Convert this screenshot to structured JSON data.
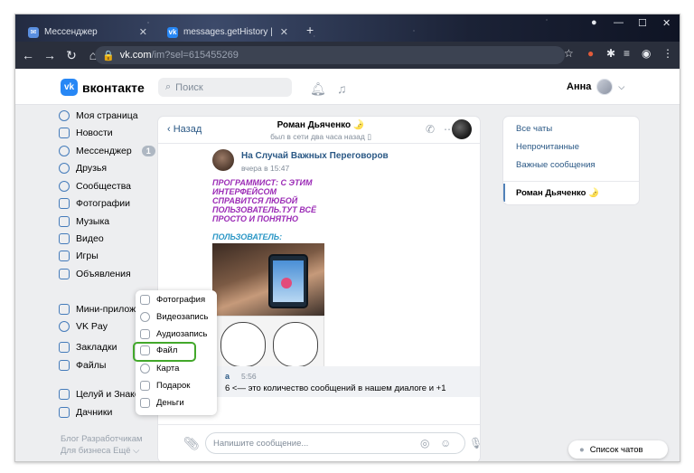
{
  "browser": {
    "tabs": [
      {
        "title": "Мессенджер",
        "icon": "vk-messenger-icon"
      },
      {
        "title": "messages.getHistory | Разработ",
        "icon": "vk-icon"
      }
    ],
    "url_host": "vk.com",
    "url_path": "/im?sel=615455269"
  },
  "header": {
    "logo_text": "вконтакте",
    "search_placeholder": "Поиск",
    "user_name": "Анна"
  },
  "sidebar": {
    "items": [
      {
        "label": "Моя страница"
      },
      {
        "label": "Новости"
      },
      {
        "label": "Мессенджер",
        "badge": "1"
      },
      {
        "label": "Друзья"
      },
      {
        "label": "Сообщества"
      },
      {
        "label": "Фотографии"
      },
      {
        "label": "Музыка"
      },
      {
        "label": "Видео"
      },
      {
        "label": "Игры"
      },
      {
        "label": "Объявления"
      },
      {
        "label": "Мини-приложен"
      },
      {
        "label": "VK Pay"
      },
      {
        "label": "Закладки"
      },
      {
        "label": "Файлы"
      },
      {
        "label": "Целуй и Знаком"
      },
      {
        "label": "Дачники"
      }
    ],
    "footer_line1": "Блог  Разработчикам",
    "footer_line2": "Для бизнеса  Ещё ⌵"
  },
  "chat": {
    "back_label": "Назад",
    "peer_name": "Роман Дьяченко 🌛",
    "peer_status": "был в сети два часа назад ▯",
    "message": {
      "author": "На Случай Важных Переговоров",
      "time": "вчера в 15:47",
      "caption_top": "ПРОГРАММИСТ: С ЭТИМ ИНТЕРФЕЙСОМ СПРАВИТСЯ ЛЮБОЙ ПОЛЬЗОВАТЕЛЬ.ТУТ ВСЁ ПРОСТО И ПОНЯТНО",
      "caption_bottom": "ПОЛЬЗОВАТЕЛЬ:"
    },
    "reply": {
      "author": "а",
      "time": "5:56",
      "text": "6 <— это количество сообщений в нашем диалоге и +1"
    },
    "composer_placeholder": "Напишите сообщение..."
  },
  "attach_menu": {
    "items": [
      {
        "label": "Фотография"
      },
      {
        "label": "Видеозапись"
      },
      {
        "label": "Аудиозапись"
      },
      {
        "label": "Файл"
      },
      {
        "label": "Карта"
      },
      {
        "label": "Подарок"
      },
      {
        "label": "Деньги"
      }
    ],
    "highlight_color": "#43a82b"
  },
  "right_panel": {
    "filters": [
      {
        "label": "Все чаты"
      },
      {
        "label": "Непрочитанные"
      },
      {
        "label": "Важные сообщения"
      }
    ],
    "active_chat": "Роман Дьяченко 🌛"
  },
  "chats_button": "Список чатов",
  "colors": {
    "vk_blue": "#2787f5",
    "link": "#2a5885"
  }
}
